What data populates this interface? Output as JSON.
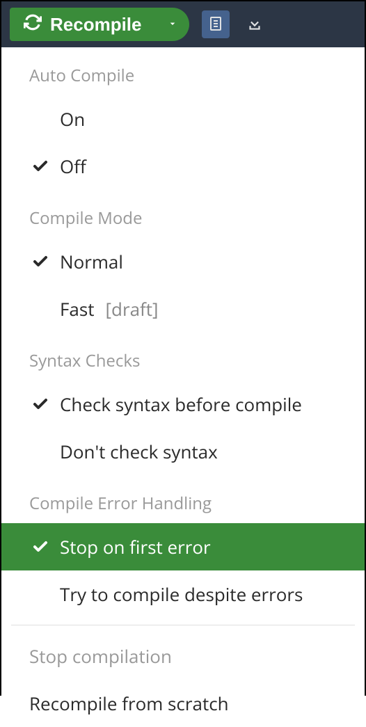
{
  "toolbar": {
    "recompile_label": "Recompile"
  },
  "menu": {
    "sections": {
      "auto_compile": {
        "header": "Auto Compile",
        "on": "On",
        "off": "Off"
      },
      "compile_mode": {
        "header": "Compile Mode",
        "normal": "Normal",
        "fast": "Fast",
        "fast_sub": "[draft]"
      },
      "syntax_checks": {
        "header": "Syntax Checks",
        "check": "Check syntax before compile",
        "dont_check": "Don't check syntax"
      },
      "error_handling": {
        "header": "Compile Error Handling",
        "stop": "Stop on first error",
        "try": "Try to compile despite errors"
      }
    },
    "actions": {
      "stop_compilation": "Stop compilation",
      "recompile_scratch": "Recompile from scratch"
    }
  }
}
